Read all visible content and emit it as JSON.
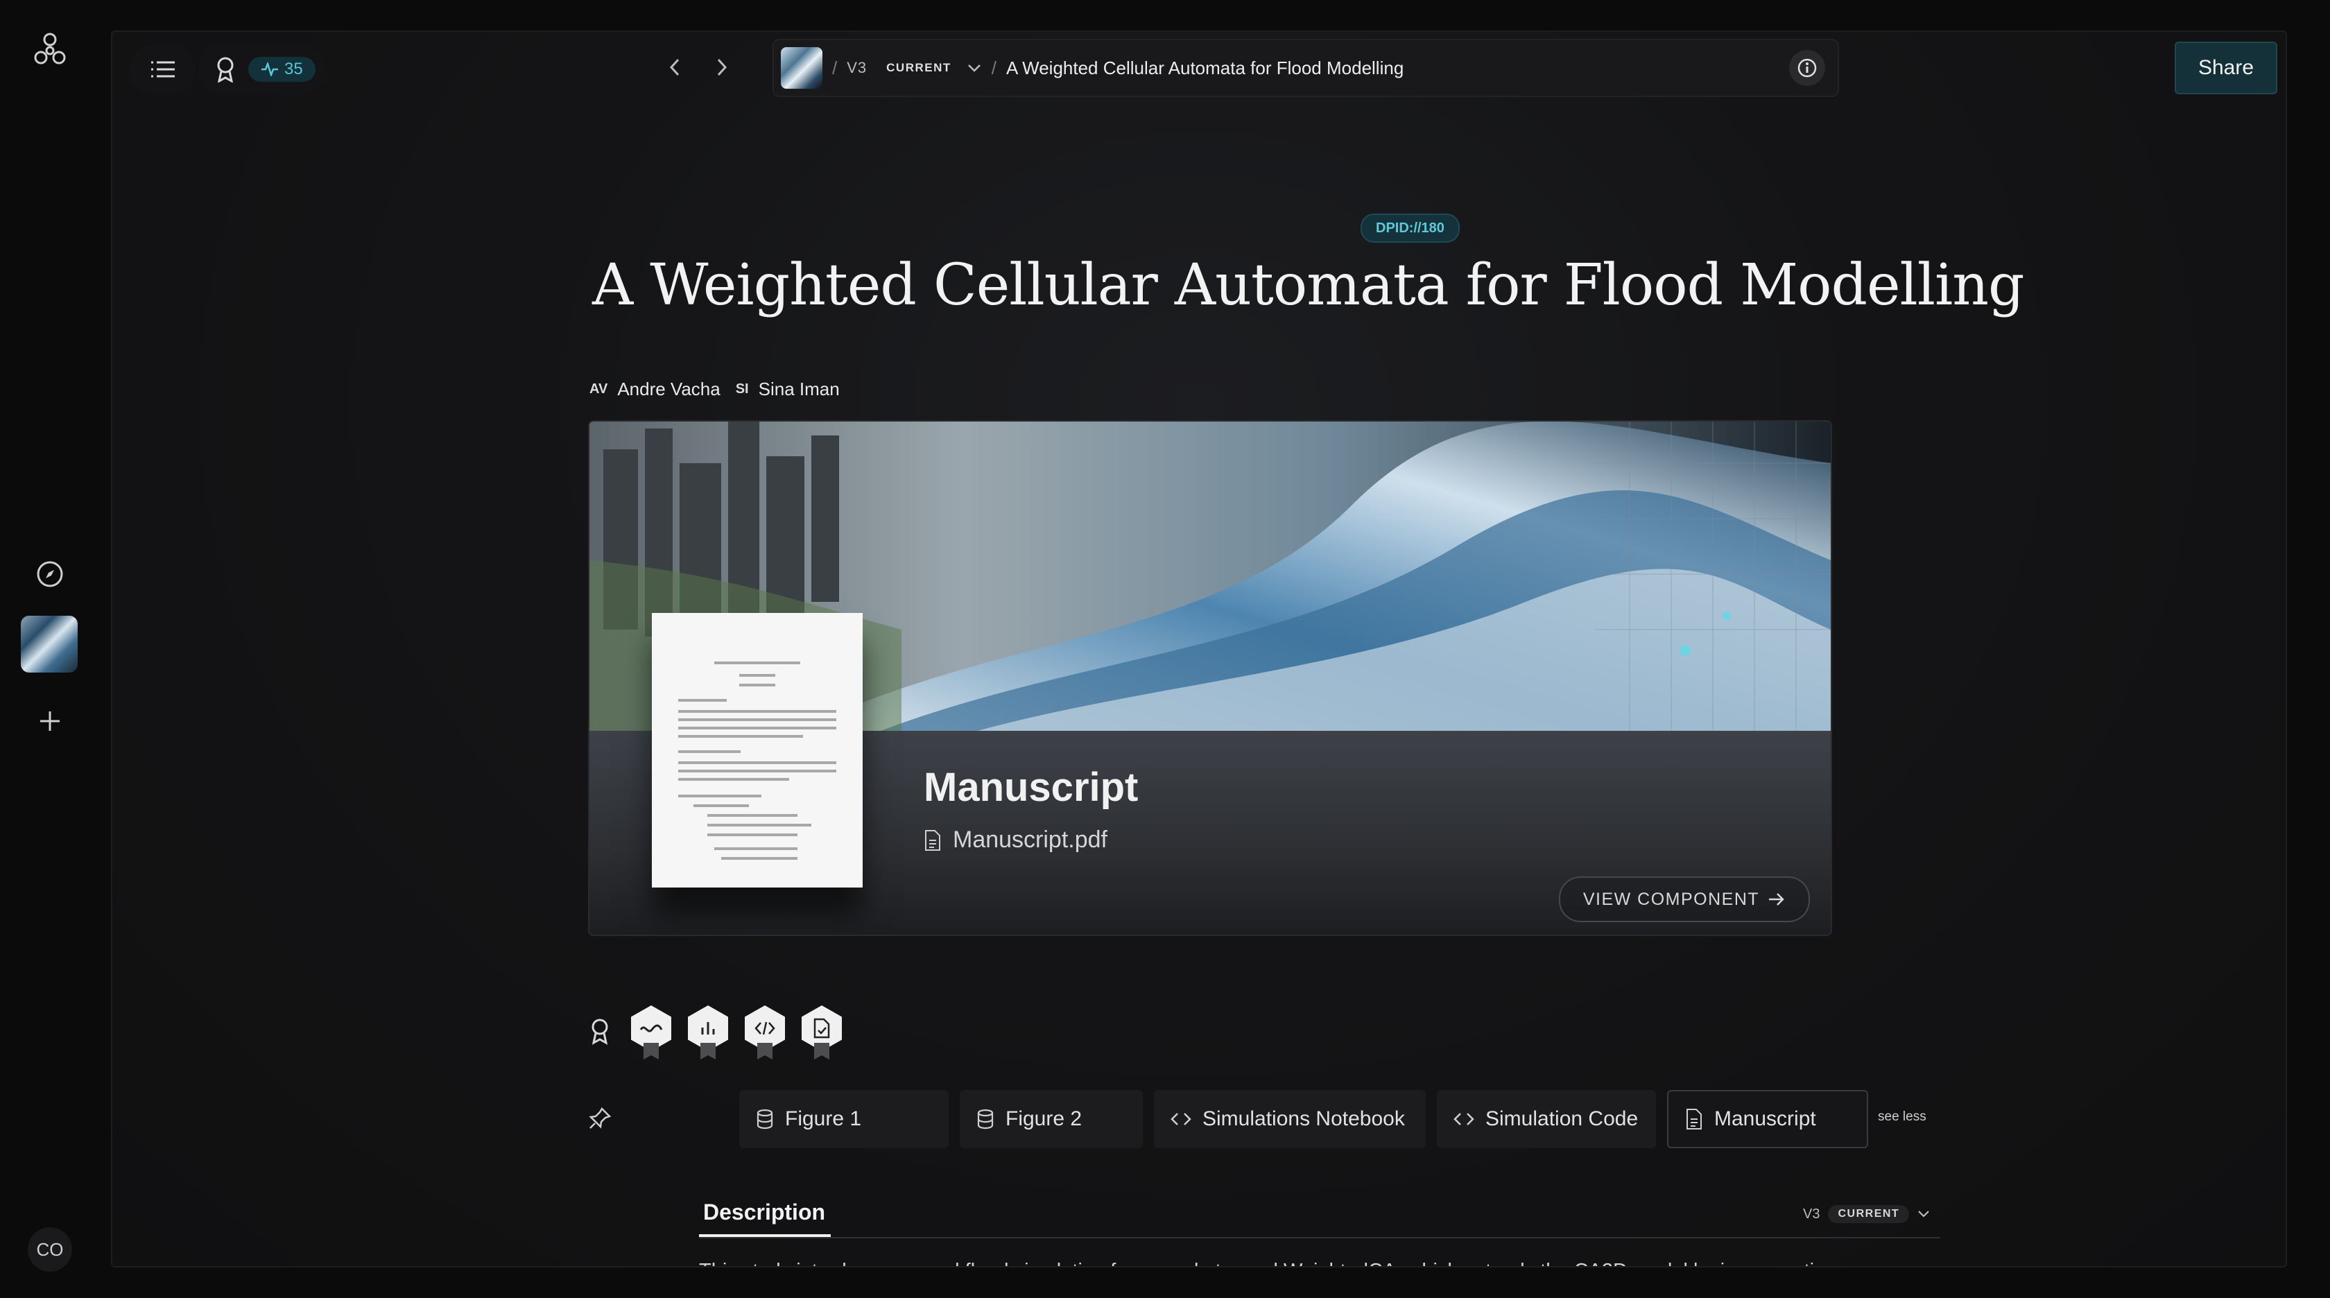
{
  "rail": {
    "avatar": "CO",
    "icons": [
      "network-logo-icon",
      "compass-icon",
      "plus-icon"
    ]
  },
  "topbar": {
    "score": "35",
    "version": "V3",
    "current": "CURRENT",
    "title": "A Weighted Cellular Automata for Flood Modelling",
    "share": "Share"
  },
  "doc": {
    "dpid": "DPID://180",
    "title": "A Weighted Cellular Automata for Flood Modelling",
    "authors": [
      {
        "initials": "AV",
        "name": "Andre Vacha"
      },
      {
        "initials": "SI",
        "name": "Sina Iman"
      }
    ]
  },
  "hero": {
    "component_title": "Manuscript",
    "file_name": "Manuscript.pdf",
    "view_button": "VIEW COMPONENT"
  },
  "tabs": [
    {
      "label": "Figure 1",
      "icon": "database-icon"
    },
    {
      "label": "Figure 2",
      "icon": "database-icon"
    },
    {
      "label": "Simulations Notebook",
      "icon": "code-icon"
    },
    {
      "label": "Simulation Code",
      "icon": "code-icon"
    },
    {
      "label": "Manuscript",
      "icon": "file-icon"
    }
  ],
  "see_less": "see less",
  "description": {
    "tab": "Description",
    "version": "V3",
    "current": "CURRENT",
    "text": "This study introduces a novel flood simulation framework, termed WeightedCA, which extends the CA2D model by incorporating"
  },
  "colors": {
    "accent": "#59c7d8",
    "accent_bg": "#12313a",
    "background": "#0b0b0c"
  }
}
